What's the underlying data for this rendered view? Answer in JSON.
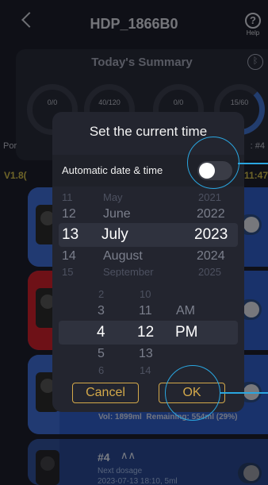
{
  "header": {
    "title": "HDP_1866B0",
    "help_label": "Help"
  },
  "summary": {
    "title": "Today's Summary",
    "gauges": [
      "0/0",
      "40/120",
      "0/0",
      "15/60"
    ],
    "partial_left": "Por",
    "partial_right": ": #4"
  },
  "version": {
    "left": "V1.8(",
    "right": "11:47"
  },
  "card3": {
    "volume": "Vol: 1899ml",
    "remaining": "Remaining: 554ml (29%)"
  },
  "card4": {
    "name": "#4",
    "next_label": "Next dosage",
    "next_value": "2023-07-13 18:10, 5ml"
  },
  "dialog": {
    "title": "Set the current time",
    "auto_label": "Automatic date & time",
    "auto_enabled": false,
    "date_picker": {
      "day": [
        "11",
        "12",
        "13",
        "14",
        "15"
      ],
      "month": [
        "May",
        "June",
        "July",
        "August",
        "September"
      ],
      "year": [
        "2021",
        "2022",
        "2023",
        "2024",
        "2025"
      ],
      "selected_index": 2
    },
    "time_picker": {
      "hour": [
        "2",
        "3",
        "4",
        "5",
        "6"
      ],
      "minute": [
        "10",
        "11",
        "12",
        "13",
        "14"
      ],
      "ampm": [
        "AM",
        "PM"
      ],
      "selected_index": 2
    },
    "cancel_label": "Cancel",
    "ok_label": "OK"
  },
  "colors": {
    "accent": "#d4a94a",
    "highlight": "#2aa6e0",
    "card_blue": "#2f5cc4",
    "card_red": "#c8202a"
  }
}
